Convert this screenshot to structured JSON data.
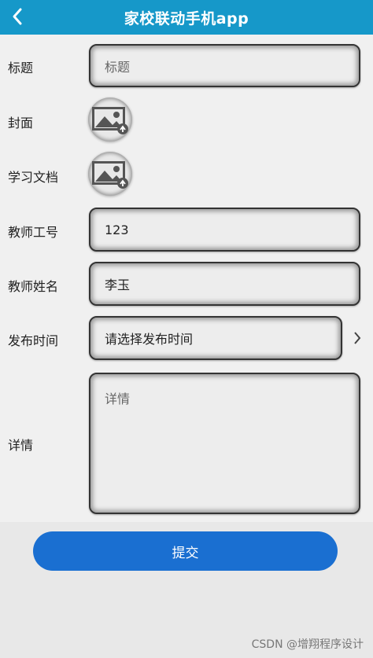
{
  "header": {
    "title": "家校联动手机app",
    "back_icon": "chevron-left-icon"
  },
  "form": {
    "title_label": "标题",
    "title_placeholder": "标题",
    "cover_label": "封面",
    "document_label": "学习文档",
    "teacher_id_label": "教师工号",
    "teacher_id_value": "123",
    "teacher_name_label": "教师姓名",
    "teacher_name_value": "李玉",
    "publish_time_label": "发布时间",
    "publish_time_placeholder": "请选择发布时间",
    "details_label": "详情",
    "details_placeholder": "详情"
  },
  "submit_label": "提交",
  "watermark": "CSDN @增翔程序设计",
  "colors": {
    "header": "#1698c9",
    "submit": "#1a6fd1"
  }
}
